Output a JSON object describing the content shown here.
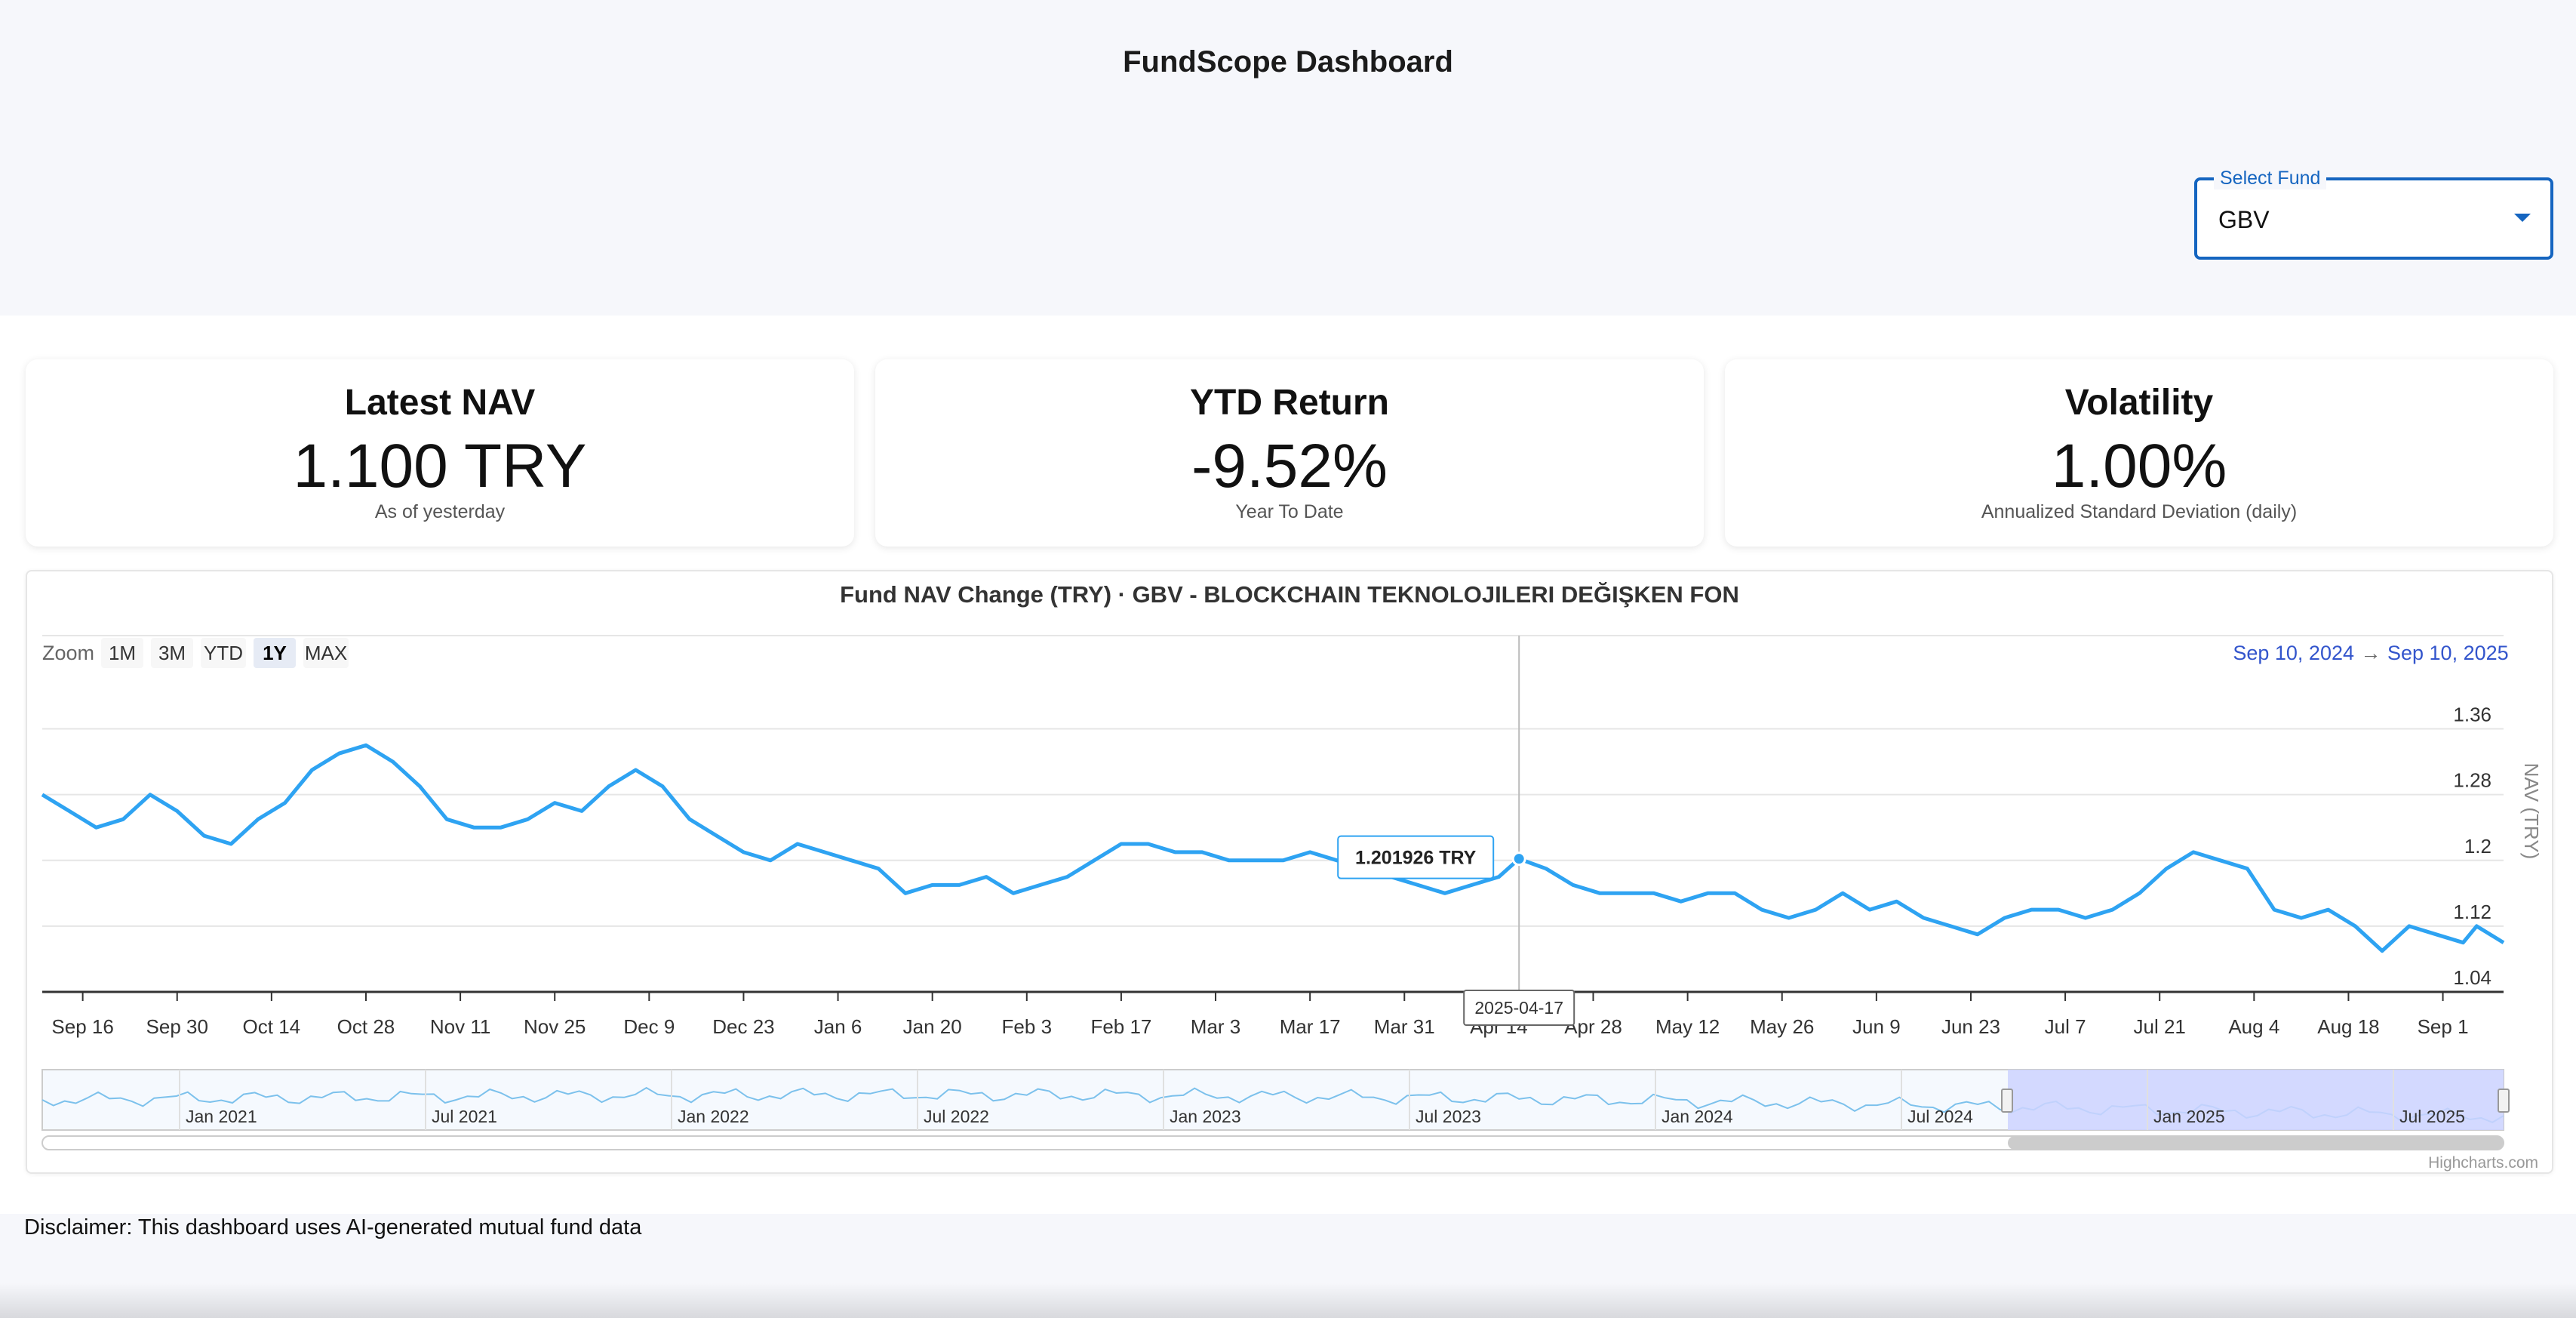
{
  "app": {
    "title": "FundScope Dashboard"
  },
  "fund_selector": {
    "label": "Select Fund",
    "value": "GBV"
  },
  "cards": [
    {
      "title": "Latest NAV",
      "value": "1.100 TRY",
      "sub": "As of yesterday"
    },
    {
      "title": "YTD Return",
      "value": "-9.52%",
      "sub": "Year To Date"
    },
    {
      "title": "Volatility",
      "value": "1.00%",
      "sub": "Annualized Standard Deviation (daily)"
    }
  ],
  "chart": {
    "title": "Fund NAV Change (TRY) · GBV - BLOCKCHAIN TEKNOLOJILERI DEĞIŞKEN FON",
    "zoom_label": "Zoom",
    "zoom_buttons": [
      "1M",
      "3M",
      "YTD",
      "1Y",
      "MAX"
    ],
    "zoom_selected": "1Y",
    "range_from": "Sep 10, 2024",
    "range_arrow": "→",
    "range_to": "Sep 10, 2025",
    "tooltip_value": "1.201926 TRY",
    "crosshair_label": "2025-04-17",
    "navigator_labels": [
      "Jan 2021",
      "Jul 2021",
      "Jan 2022",
      "Jul 2022",
      "Jan 2023",
      "Jul 2023",
      "Jan 2024",
      "Jul 2024",
      "Jan 2025",
      "Jul 2025"
    ],
    "credits": "Highcharts.com",
    "line_color": "#2ea3f2",
    "navigator_fill": "#ccd3ff"
  },
  "chart_data": {
    "type": "line",
    "title": "Fund NAV Change (TRY) · GBV - BLOCKCHAIN TEKNOLOJILERI DEĞIŞKEN FON",
    "xlabel": "",
    "ylabel": "NAV (TRY)",
    "x_tick_labels": [
      "Sep 16",
      "Sep 30",
      "Oct 14",
      "Oct 28",
      "Nov 11",
      "Nov 25",
      "Dec 9",
      "Dec 23",
      "Jan 6",
      "Jan 20",
      "Feb 3",
      "Feb 17",
      "Mar 3",
      "Mar 17",
      "Mar 31",
      "Apr 14",
      "Apr 28",
      "May 12",
      "May 26",
      "Jun 9",
      "Jun 23",
      "Jul 7",
      "Jul 21",
      "Aug 4",
      "Aug 18",
      "Sep 1"
    ],
    "y_ticks": [
      1.04,
      1.12,
      1.2,
      1.28,
      1.36
    ],
    "ylim": [
      1.04,
      1.4
    ],
    "x_range": [
      "2024-09-10",
      "2025-09-10"
    ],
    "grid": true,
    "series": [
      {
        "points": [
          [
            "2024-09-10",
            1.28
          ],
          [
            "2024-09-14",
            1.26
          ],
          [
            "2024-09-18",
            1.24
          ],
          [
            "2024-09-22",
            1.25
          ],
          [
            "2024-09-26",
            1.28
          ],
          [
            "2024-09-30",
            1.26
          ],
          [
            "2024-10-04",
            1.23
          ],
          [
            "2024-10-08",
            1.22
          ],
          [
            "2024-10-12",
            1.25
          ],
          [
            "2024-10-16",
            1.27
          ],
          [
            "2024-10-20",
            1.31
          ],
          [
            "2024-10-24",
            1.33
          ],
          [
            "2024-10-28",
            1.34
          ],
          [
            "2024-11-01",
            1.32
          ],
          [
            "2024-11-05",
            1.29
          ],
          [
            "2024-11-09",
            1.25
          ],
          [
            "2024-11-13",
            1.24
          ],
          [
            "2024-11-17",
            1.24
          ],
          [
            "2024-11-21",
            1.25
          ],
          [
            "2024-11-25",
            1.27
          ],
          [
            "2024-11-29",
            1.26
          ],
          [
            "2024-12-03",
            1.29
          ],
          [
            "2024-12-07",
            1.31
          ],
          [
            "2024-12-11",
            1.29
          ],
          [
            "2024-12-15",
            1.25
          ],
          [
            "2024-12-19",
            1.23
          ],
          [
            "2024-12-23",
            1.21
          ],
          [
            "2024-12-27",
            1.2
          ],
          [
            "2024-12-31",
            1.22
          ],
          [
            "2025-01-04",
            1.21
          ],
          [
            "2025-01-08",
            1.2
          ],
          [
            "2025-01-12",
            1.19
          ],
          [
            "2025-01-16",
            1.16
          ],
          [
            "2025-01-20",
            1.17
          ],
          [
            "2025-01-24",
            1.17
          ],
          [
            "2025-01-28",
            1.18
          ],
          [
            "2025-02-01",
            1.16
          ],
          [
            "2025-02-05",
            1.17
          ],
          [
            "2025-02-09",
            1.18
          ],
          [
            "2025-02-13",
            1.2
          ],
          [
            "2025-02-17",
            1.22
          ],
          [
            "2025-02-21",
            1.22
          ],
          [
            "2025-02-25",
            1.21
          ],
          [
            "2025-03-01",
            1.21
          ],
          [
            "2025-03-05",
            1.2
          ],
          [
            "2025-03-09",
            1.2
          ],
          [
            "2025-03-13",
            1.2
          ],
          [
            "2025-03-17",
            1.21
          ],
          [
            "2025-03-21",
            1.2
          ],
          [
            "2025-03-25",
            1.19
          ],
          [
            "2025-03-29",
            1.18
          ],
          [
            "2025-04-02",
            1.17
          ],
          [
            "2025-04-06",
            1.16
          ],
          [
            "2025-04-10",
            1.17
          ],
          [
            "2025-04-14",
            1.18
          ],
          [
            "2025-04-17",
            1.201926
          ],
          [
            "2025-04-21",
            1.19
          ],
          [
            "2025-04-25",
            1.17
          ],
          [
            "2025-04-29",
            1.16
          ],
          [
            "2025-05-03",
            1.16
          ],
          [
            "2025-05-07",
            1.16
          ],
          [
            "2025-05-11",
            1.15
          ],
          [
            "2025-05-15",
            1.16
          ],
          [
            "2025-05-19",
            1.16
          ],
          [
            "2025-05-23",
            1.14
          ],
          [
            "2025-05-27",
            1.13
          ],
          [
            "2025-05-31",
            1.14
          ],
          [
            "2025-06-04",
            1.16
          ],
          [
            "2025-06-08",
            1.14
          ],
          [
            "2025-06-12",
            1.15
          ],
          [
            "2025-06-16",
            1.13
          ],
          [
            "2025-06-20",
            1.12
          ],
          [
            "2025-06-24",
            1.11
          ],
          [
            "2025-06-28",
            1.13
          ],
          [
            "2025-07-02",
            1.14
          ],
          [
            "2025-07-06",
            1.14
          ],
          [
            "2025-07-10",
            1.13
          ],
          [
            "2025-07-14",
            1.14
          ],
          [
            "2025-07-18",
            1.16
          ],
          [
            "2025-07-22",
            1.19
          ],
          [
            "2025-07-26",
            1.21
          ],
          [
            "2025-07-30",
            1.2
          ],
          [
            "2025-08-03",
            1.19
          ],
          [
            "2025-08-07",
            1.14
          ],
          [
            "2025-08-11",
            1.13
          ],
          [
            "2025-08-15",
            1.14
          ],
          [
            "2025-08-19",
            1.12
          ],
          [
            "2025-08-23",
            1.09
          ],
          [
            "2025-08-27",
            1.12
          ],
          [
            "2025-08-31",
            1.11
          ],
          [
            "2025-09-04",
            1.1
          ],
          [
            "2025-09-06",
            1.12
          ],
          [
            "2025-09-10",
            1.1
          ]
        ]
      }
    ]
  }
}
